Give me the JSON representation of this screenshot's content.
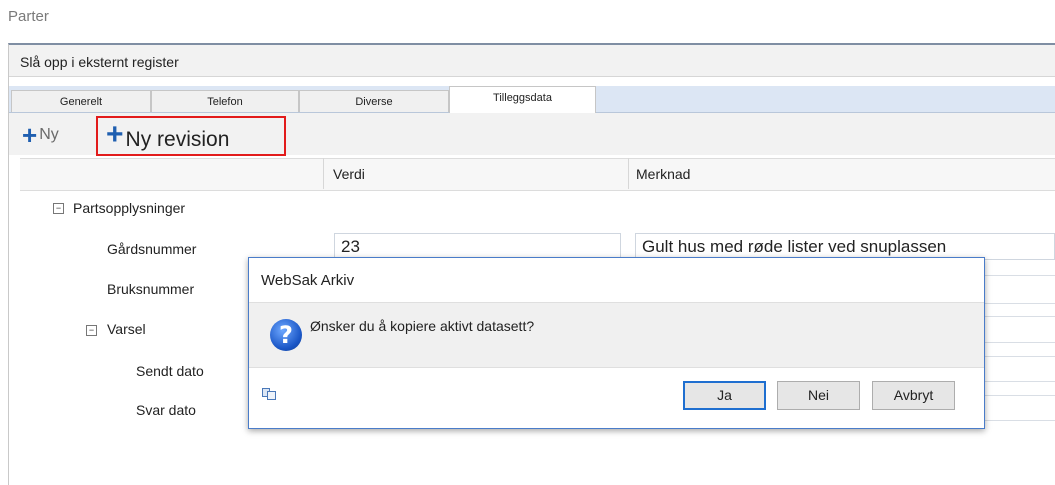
{
  "page": {
    "title": "Parter"
  },
  "lookup": {
    "label": "Slå opp i eksternt register"
  },
  "tabs": [
    {
      "label": "Generelt"
    },
    {
      "label": "Telefon"
    },
    {
      "label": "Diverse"
    },
    {
      "label": "Tilleggsdata",
      "active": true
    }
  ],
  "toolbar": {
    "new_label": "Ny",
    "new_revision_label": "Ny revision",
    "plus_icon": "plus-icon",
    "highlight_color": "#e21b1b"
  },
  "grid": {
    "headers": [
      "Verdi",
      "Merknad"
    ],
    "rows": [
      {
        "label": "Partsopplysninger",
        "group": true,
        "collapse_glyph": "−"
      },
      {
        "label": "Gårdsnummer",
        "value": "23",
        "note": "Gult hus med røde lister ved snuplassen"
      },
      {
        "label": "Bruksnummer"
      },
      {
        "label": "Varsel",
        "group": true,
        "collapse_glyph": "−"
      },
      {
        "label": "Sendt dato"
      },
      {
        "label": "Svar dato"
      }
    ]
  },
  "dialog": {
    "title": "WebSak Arkiv",
    "message": "Ønsker du å kopiere aktivt datasett?",
    "icon": "question-icon",
    "icon_glyph": "?",
    "buttons": {
      "yes": "Ja",
      "no": "Nei",
      "cancel": "Avbryt"
    }
  }
}
